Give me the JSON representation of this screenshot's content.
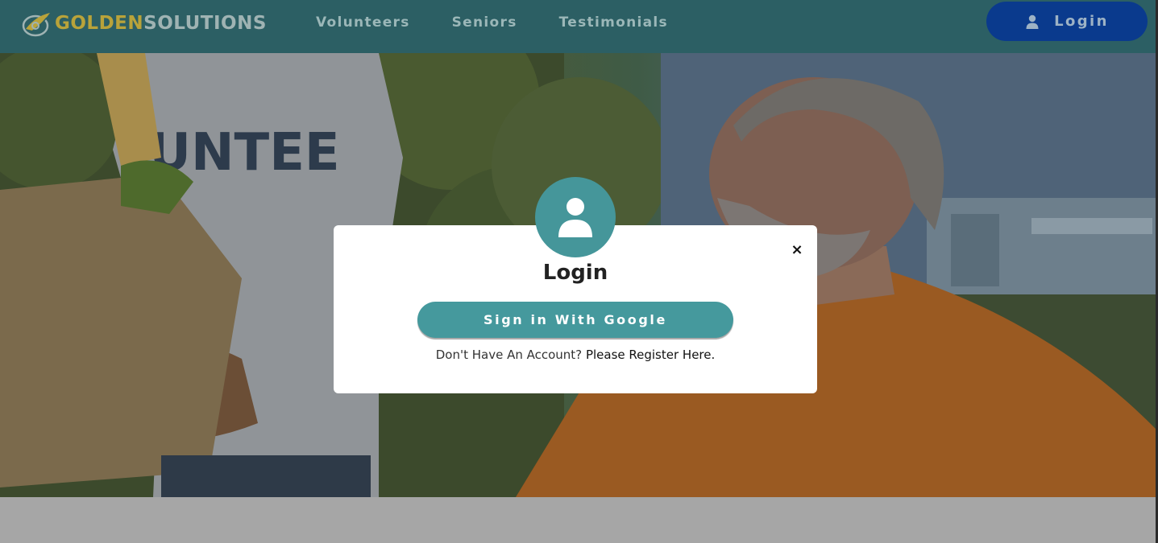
{
  "brand": {
    "part1": "GOLDEN",
    "part2": "SOLUTIONS"
  },
  "nav": {
    "links": [
      "Volunteers",
      "Seniors",
      "Testimonials"
    ],
    "login_label": "Login"
  },
  "hero": {
    "shirt_text": "UNTEE"
  },
  "modal": {
    "title": "Login",
    "google_button": "Sign in With Google",
    "register_prompt": "Don't Have An Account?",
    "register_link": "Please Register Here.",
    "close_symbol": "×"
  },
  "colors": {
    "navbar": "#2c5f64",
    "login_button": "#0a3a8d",
    "accent_teal": "#45999d",
    "logo_gold": "#b9a33a"
  },
  "icons": {
    "logo": "leaf-globe-logo-icon",
    "nav_login": "user-icon",
    "modal_avatar": "user-avatar-icon",
    "close": "close-icon"
  }
}
